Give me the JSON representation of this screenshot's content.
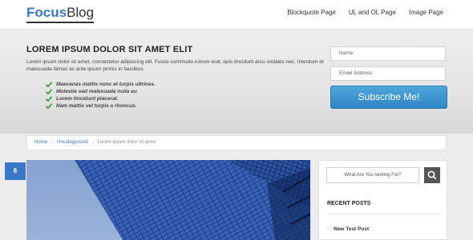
{
  "header": {
    "logo_part1": "Focus",
    "logo_part2": "Blog",
    "nav": [
      "Blockquote Page",
      "UL and OL Page",
      "Image Page"
    ]
  },
  "hero": {
    "title": "LOREM IPSUM DOLOR SIT AMET ELIT",
    "description": "Lorem ipsum dolor sit amet, consectetur adipiscing elit. Fusce commodo rutrum erat, quis tincidunt arcu sodales nec. Interdum et malesuada fames ac ante ipsum primis in faucibus.",
    "checklist": [
      "Maecenas mattis nunc et turpis ultrices.",
      "Molestie sed malesuada nulla eu",
      "Lorem tincidunt placerat.",
      "Nam mattis vel turpis a rhoncus."
    ],
    "check_icon": "check-icon",
    "check_color": "#3aa53a"
  },
  "subscribe_form": {
    "name_placeholder": "Name",
    "email_placeholder": "Email Address",
    "button_label": "Subscribe Me!"
  },
  "breadcrumb": {
    "items": [
      "Home",
      "Uncategorized",
      "Lorem ipsum dolor sit amet"
    ],
    "separator": "→"
  },
  "post": {
    "date_day": "6"
  },
  "sidebar": {
    "search_placeholder": "What Are You looking For?",
    "search_icon": "search-icon",
    "recent_title": "RECENT POSTS",
    "recent_posts": [
      "New Test Post"
    ]
  },
  "colors": {
    "accent": "#3b78c8",
    "subscribe_button": "#3a93d0"
  }
}
